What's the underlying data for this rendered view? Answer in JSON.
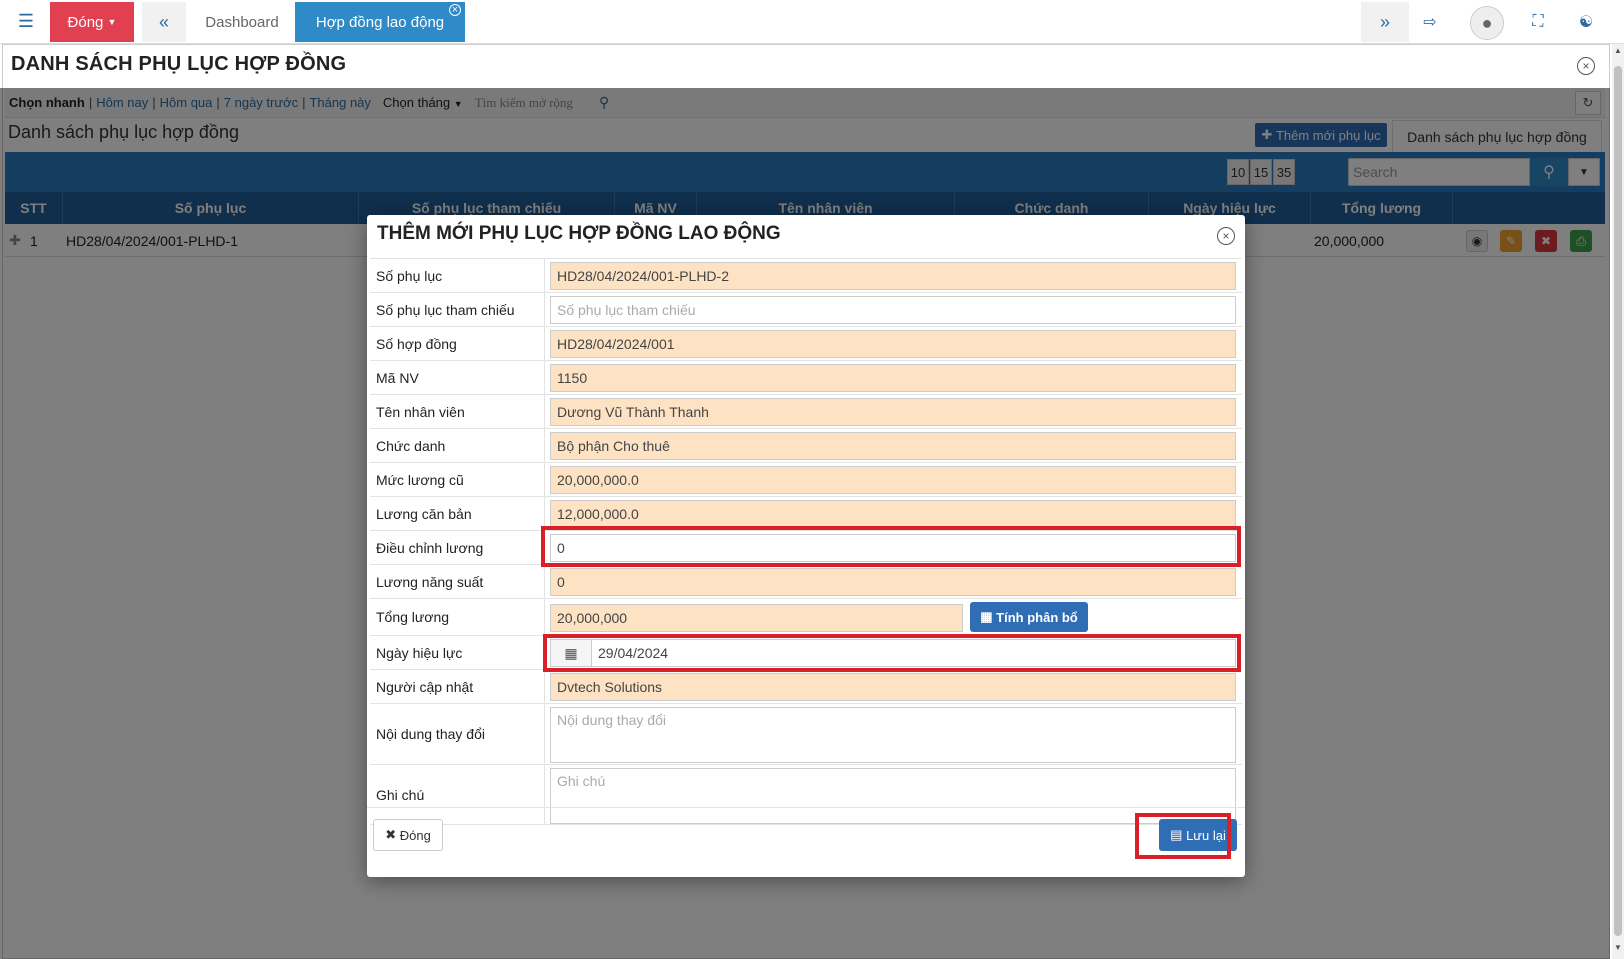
{
  "topbar": {
    "close_menu_label": "Đóng",
    "tabs": [
      "Dashboard",
      "Hợp đồng lao động"
    ]
  },
  "window": {
    "title": "DANH SÁCH PHỤ LỤC HỢP ĐỒNG"
  },
  "filter": {
    "quick_label": "Chọn nhanh",
    "links": [
      "Hôm nay",
      "Hôm qua",
      "7 ngày trước",
      "Tháng này"
    ],
    "month_select": "Chọn tháng",
    "extended_search": "Tìm kiếm mở rộng"
  },
  "list": {
    "title": "Danh sách phụ lục hợp đồng",
    "add_button": "Thêm mới phụ lục",
    "tab_label": "Danh sách phụ lục hợp đồng",
    "page_sizes": [
      "10",
      "15",
      "35"
    ],
    "search_placeholder": "Search",
    "columns": [
      "STT",
      "Số phụ lục",
      "Số phụ lục tham chiếu",
      "Mã NV",
      "Tên nhân viên",
      "Chức danh",
      "Ngày hiệu lực",
      "Tổng lương"
    ],
    "rows": [
      {
        "stt": "1",
        "so_phu_luc": "HD28/04/2024/001-PLHD-1",
        "tong_luong": "20,000,000"
      }
    ]
  },
  "modal": {
    "title": "THÊM MỚI PHỤ LỤC HỢP ĐỒNG LAO ĐỘNG",
    "fields": {
      "so_phu_luc": {
        "label": "Số phụ lục",
        "value": "HD28/04/2024/001-PLHD-2"
      },
      "so_phu_luc_tham_chieu": {
        "label": "Số phụ lục tham chiếu",
        "placeholder": "Số phụ lục tham chiếu"
      },
      "so_hop_dong": {
        "label": "Số hợp đồng",
        "value": "HD28/04/2024/001"
      },
      "ma_nv": {
        "label": "Mã NV",
        "value": "1150"
      },
      "ten_nhan_vien": {
        "label": "Tên nhân viên",
        "value": "Dương Vũ Thành Thanh"
      },
      "chuc_danh": {
        "label": "Chức danh",
        "value": "Bộ phận Cho thuê"
      },
      "muc_luong_cu": {
        "label": "Mức lương cũ",
        "value": "20,000,000.0"
      },
      "luong_can_ban": {
        "label": "Lương căn bản",
        "value": "12,000,000.0"
      },
      "dieu_chinh_luong": {
        "label": "Điều chỉnh lương",
        "value": "0"
      },
      "luong_nang_suat": {
        "label": "Lương năng suất",
        "value": "0"
      },
      "tong_luong": {
        "label": "Tổng lương",
        "value": "20,000,000"
      },
      "ngay_hieu_luc": {
        "label": "Ngày hiệu lực",
        "value": "29/04/2024"
      },
      "nguoi_cap_nhat": {
        "label": "Người cập nhật",
        "value": "Dvtech Solutions"
      },
      "noi_dung_thay_doi": {
        "label": "Nội dung thay đổi",
        "placeholder": "Nội dung thay đổi"
      },
      "ghi_chu": {
        "label": "Ghi chú",
        "placeholder": "Ghi chú"
      }
    },
    "calc_button": "Tính phân bổ",
    "close_button": "Đóng",
    "save_button": "Lưu lại"
  },
  "colors": {
    "primary": "#2f8ac8",
    "danger": "#e04050",
    "highlight": "#d9202a",
    "readonly_field": "#fde3c3"
  }
}
